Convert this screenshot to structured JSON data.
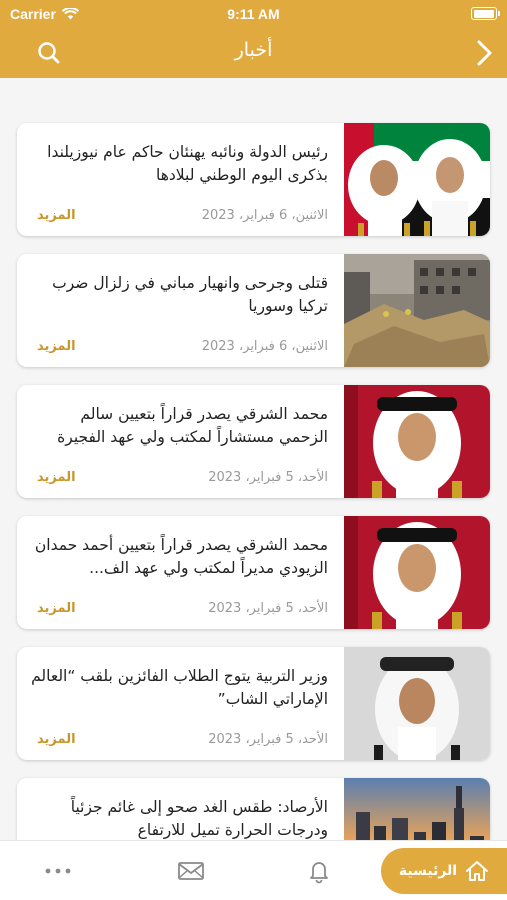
{
  "status_bar": {
    "carrier": "Carrier",
    "time": "9:11 AM"
  },
  "header": {
    "title": "أخبار"
  },
  "news": [
    {
      "headline": "رئيس الدولة ونائبه يهنئان حاكم عام نيوزيلندا بذكرى اليوم الوطني لبلادها",
      "date": "الاثنين، 6 فبراير، 2023",
      "more": "المزيد"
    },
    {
      "headline": "قتلى وجرحى وانهيار مباني في زلزال ضرب تركيا وسوريا",
      "date": "الاثنين، 6 فبراير، 2023",
      "more": "المزيد"
    },
    {
      "headline": "محمد الشرقي يصدر قراراً بتعيين سالم الزحمي مستشاراً لمكتب ولي عهد الفجيرة",
      "date": "الأحد، 5 فبراير، 2023",
      "more": "المزيد"
    },
    {
      "headline": "محمد الشرقي يصدر قراراً بتعيين أحمد حمدان الزيودي مديراً لمكتب ولي عهد الف...",
      "date": "الأحد، 5 فبراير، 2023",
      "more": "المزيد"
    },
    {
      "headline": "وزير التربية يتوج الطلاب الفائزين بلقب “العالم الإماراتي الشاب”",
      "date": "الأحد، 5 فبراير، 2023",
      "more": "المزيد"
    },
    {
      "headline": "الأرصاد: طقس الغد صحو إلى غائم جزئياً ودرجات الحرارة تميل للارتفاع",
      "date": "",
      "more": ""
    }
  ],
  "tabbar": {
    "home_label": "الرئيسية"
  },
  "colors": {
    "brand_gold": "#e0aa3e",
    "link_gold": "#c8962a"
  }
}
